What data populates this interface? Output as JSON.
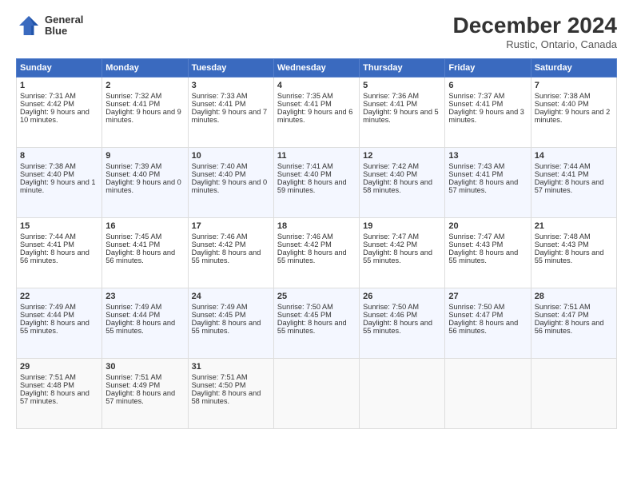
{
  "logo": {
    "line1": "General",
    "line2": "Blue"
  },
  "title": "December 2024",
  "subtitle": "Rustic, Ontario, Canada",
  "days_of_week": [
    "Sunday",
    "Monday",
    "Tuesday",
    "Wednesday",
    "Thursday",
    "Friday",
    "Saturday"
  ],
  "weeks": [
    [
      {
        "day": "1",
        "sunrise": "7:31 AM",
        "sunset": "4:42 PM",
        "daylight": "9 hours and 10 minutes."
      },
      {
        "day": "2",
        "sunrise": "7:32 AM",
        "sunset": "4:41 PM",
        "daylight": "9 hours and 9 minutes."
      },
      {
        "day": "3",
        "sunrise": "7:33 AM",
        "sunset": "4:41 PM",
        "daylight": "9 hours and 7 minutes."
      },
      {
        "day": "4",
        "sunrise": "7:35 AM",
        "sunset": "4:41 PM",
        "daylight": "9 hours and 6 minutes."
      },
      {
        "day": "5",
        "sunrise": "7:36 AM",
        "sunset": "4:41 PM",
        "daylight": "9 hours and 5 minutes."
      },
      {
        "day": "6",
        "sunrise": "7:37 AM",
        "sunset": "4:41 PM",
        "daylight": "9 hours and 3 minutes."
      },
      {
        "day": "7",
        "sunrise": "7:38 AM",
        "sunset": "4:40 PM",
        "daylight": "9 hours and 2 minutes."
      }
    ],
    [
      {
        "day": "8",
        "sunrise": "7:38 AM",
        "sunset": "4:40 PM",
        "daylight": "9 hours and 1 minute."
      },
      {
        "day": "9",
        "sunrise": "7:39 AM",
        "sunset": "4:40 PM",
        "daylight": "9 hours and 0 minutes."
      },
      {
        "day": "10",
        "sunrise": "7:40 AM",
        "sunset": "4:40 PM",
        "daylight": "9 hours and 0 minutes."
      },
      {
        "day": "11",
        "sunrise": "7:41 AM",
        "sunset": "4:40 PM",
        "daylight": "8 hours and 59 minutes."
      },
      {
        "day": "12",
        "sunrise": "7:42 AM",
        "sunset": "4:40 PM",
        "daylight": "8 hours and 58 minutes."
      },
      {
        "day": "13",
        "sunrise": "7:43 AM",
        "sunset": "4:41 PM",
        "daylight": "8 hours and 57 minutes."
      },
      {
        "day": "14",
        "sunrise": "7:44 AM",
        "sunset": "4:41 PM",
        "daylight": "8 hours and 57 minutes."
      }
    ],
    [
      {
        "day": "15",
        "sunrise": "7:44 AM",
        "sunset": "4:41 PM",
        "daylight": "8 hours and 56 minutes."
      },
      {
        "day": "16",
        "sunrise": "7:45 AM",
        "sunset": "4:41 PM",
        "daylight": "8 hours and 56 minutes."
      },
      {
        "day": "17",
        "sunrise": "7:46 AM",
        "sunset": "4:42 PM",
        "daylight": "8 hours and 55 minutes."
      },
      {
        "day": "18",
        "sunrise": "7:46 AM",
        "sunset": "4:42 PM",
        "daylight": "8 hours and 55 minutes."
      },
      {
        "day": "19",
        "sunrise": "7:47 AM",
        "sunset": "4:42 PM",
        "daylight": "8 hours and 55 minutes."
      },
      {
        "day": "20",
        "sunrise": "7:47 AM",
        "sunset": "4:43 PM",
        "daylight": "8 hours and 55 minutes."
      },
      {
        "day": "21",
        "sunrise": "7:48 AM",
        "sunset": "4:43 PM",
        "daylight": "8 hours and 55 minutes."
      }
    ],
    [
      {
        "day": "22",
        "sunrise": "7:49 AM",
        "sunset": "4:44 PM",
        "daylight": "8 hours and 55 minutes."
      },
      {
        "day": "23",
        "sunrise": "7:49 AM",
        "sunset": "4:44 PM",
        "daylight": "8 hours and 55 minutes."
      },
      {
        "day": "24",
        "sunrise": "7:49 AM",
        "sunset": "4:45 PM",
        "daylight": "8 hours and 55 minutes."
      },
      {
        "day": "25",
        "sunrise": "7:50 AM",
        "sunset": "4:45 PM",
        "daylight": "8 hours and 55 minutes."
      },
      {
        "day": "26",
        "sunrise": "7:50 AM",
        "sunset": "4:46 PM",
        "daylight": "8 hours and 55 minutes."
      },
      {
        "day": "27",
        "sunrise": "7:50 AM",
        "sunset": "4:47 PM",
        "daylight": "8 hours and 56 minutes."
      },
      {
        "day": "28",
        "sunrise": "7:51 AM",
        "sunset": "4:47 PM",
        "daylight": "8 hours and 56 minutes."
      }
    ],
    [
      {
        "day": "29",
        "sunrise": "7:51 AM",
        "sunset": "4:48 PM",
        "daylight": "8 hours and 57 minutes."
      },
      {
        "day": "30",
        "sunrise": "7:51 AM",
        "sunset": "4:49 PM",
        "daylight": "8 hours and 57 minutes."
      },
      {
        "day": "31",
        "sunrise": "7:51 AM",
        "sunset": "4:50 PM",
        "daylight": "8 hours and 58 minutes."
      },
      null,
      null,
      null,
      null
    ]
  ]
}
